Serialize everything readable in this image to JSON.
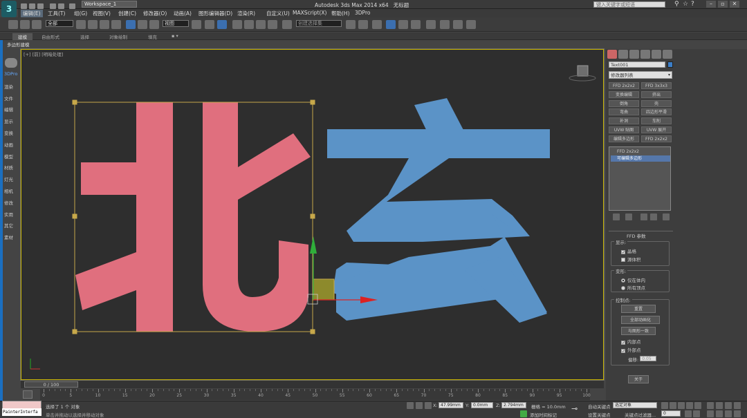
{
  "app": {
    "title": "Autodesk 3ds Max 2014 x64",
    "file": "无标题",
    "workspace": "Workspace_1",
    "search_placeholder": "键入关键字或短语"
  },
  "menu": [
    "编辑(E)",
    "工具(T)",
    "组(G)",
    "视图(V)",
    "创建(C)",
    "修改器(O)",
    "动画(A)",
    "图形编辑器(D)",
    "渲染(R)",
    "自定义(U)",
    "MAXScript(X)",
    "帮助(H)",
    "3DPro"
  ],
  "toolbar": {
    "selection_filter": "全部",
    "refcoord": "视图",
    "named_sel_set": "创建选择集"
  },
  "ribbon": {
    "tabs": [
      "建模",
      "自由形式",
      "选择",
      "对象绘制",
      "填充"
    ],
    "subtitle": "多边形建模"
  },
  "viewport": {
    "label": "[+] [前] [明暗处理]",
    "text_left": "北",
    "text_right": "玄",
    "colors": {
      "left": "#e06f7e",
      "right": "#5b93c7",
      "bbox": "#c7a84a",
      "background": "#2e2e2e"
    }
  },
  "command_panel_labels": [
    "3DPro",
    "渲染",
    "文件",
    "编辑",
    "显示",
    "变换",
    "动画",
    "模型",
    "材质",
    "灯光",
    "相机",
    "修改",
    "实用",
    "其它",
    "素材"
  ],
  "right_panel": {
    "object_name": "Text001",
    "object_color": "#3b7ec8",
    "modifier_list": "修改器列表",
    "modifier_buttons": [
      "FFD 2x2x2",
      "FFD 3x3x3",
      "变换编辑",
      "挤出",
      "倒角",
      "壳",
      "弯曲",
      "四边形平滑",
      "补洞",
      "车削",
      "UVW 贴图",
      "UVW 展开",
      "编辑多边形",
      "FFD 2x2x2"
    ],
    "stack": [
      "FFD 2x2x2",
      "可编辑多边形"
    ],
    "rollout_title": "FFD 参数",
    "display_group": "显示:",
    "display_opts": [
      {
        "label": "晶格",
        "checked": true
      },
      {
        "label": "源体积",
        "checked": false
      }
    ],
    "deform_group": "变形:",
    "deform_opts": [
      {
        "label": "仅在体内",
        "on": true
      },
      {
        "label": "所有顶点",
        "on": false
      }
    ],
    "ctrl_group": "控制点:",
    "ctrl_buttons": [
      "重置",
      "全部动画化",
      "与图形一致"
    ],
    "ctrl_checks": [
      {
        "label": "内部点",
        "checked": true
      },
      {
        "label": "外部点",
        "checked": true
      }
    ],
    "offset_label": "偏移:",
    "offset_value": "0.05",
    "about_button": "关于"
  },
  "timeline": {
    "slider": "0 / 100",
    "ticks": [
      "0",
      "5",
      "10",
      "15",
      "20",
      "25",
      "30",
      "35",
      "40",
      "45",
      "50",
      "55",
      "60",
      "65",
      "70",
      "75",
      "80",
      "85",
      "90",
      "95",
      "100"
    ]
  },
  "status": {
    "maxscript": "PainterInterfa",
    "selected": "选择了 1 个 对象",
    "hint": "单击并拖动以选择并移动对象",
    "x_label": "X:",
    "x_value": "47.99mm",
    "y_label": "Y:",
    "y_value": "0.0mm",
    "z_label": "Z:",
    "z_value": "2.794mm",
    "grid": "栅格 = 10.0mm",
    "add_time_tag": "添加时间标记",
    "auto_key": "自动关键点",
    "set_key": "设置关键点",
    "sel_filter": "选定对象",
    "key_filters": "关键点过滤器...",
    "frame": "0"
  }
}
